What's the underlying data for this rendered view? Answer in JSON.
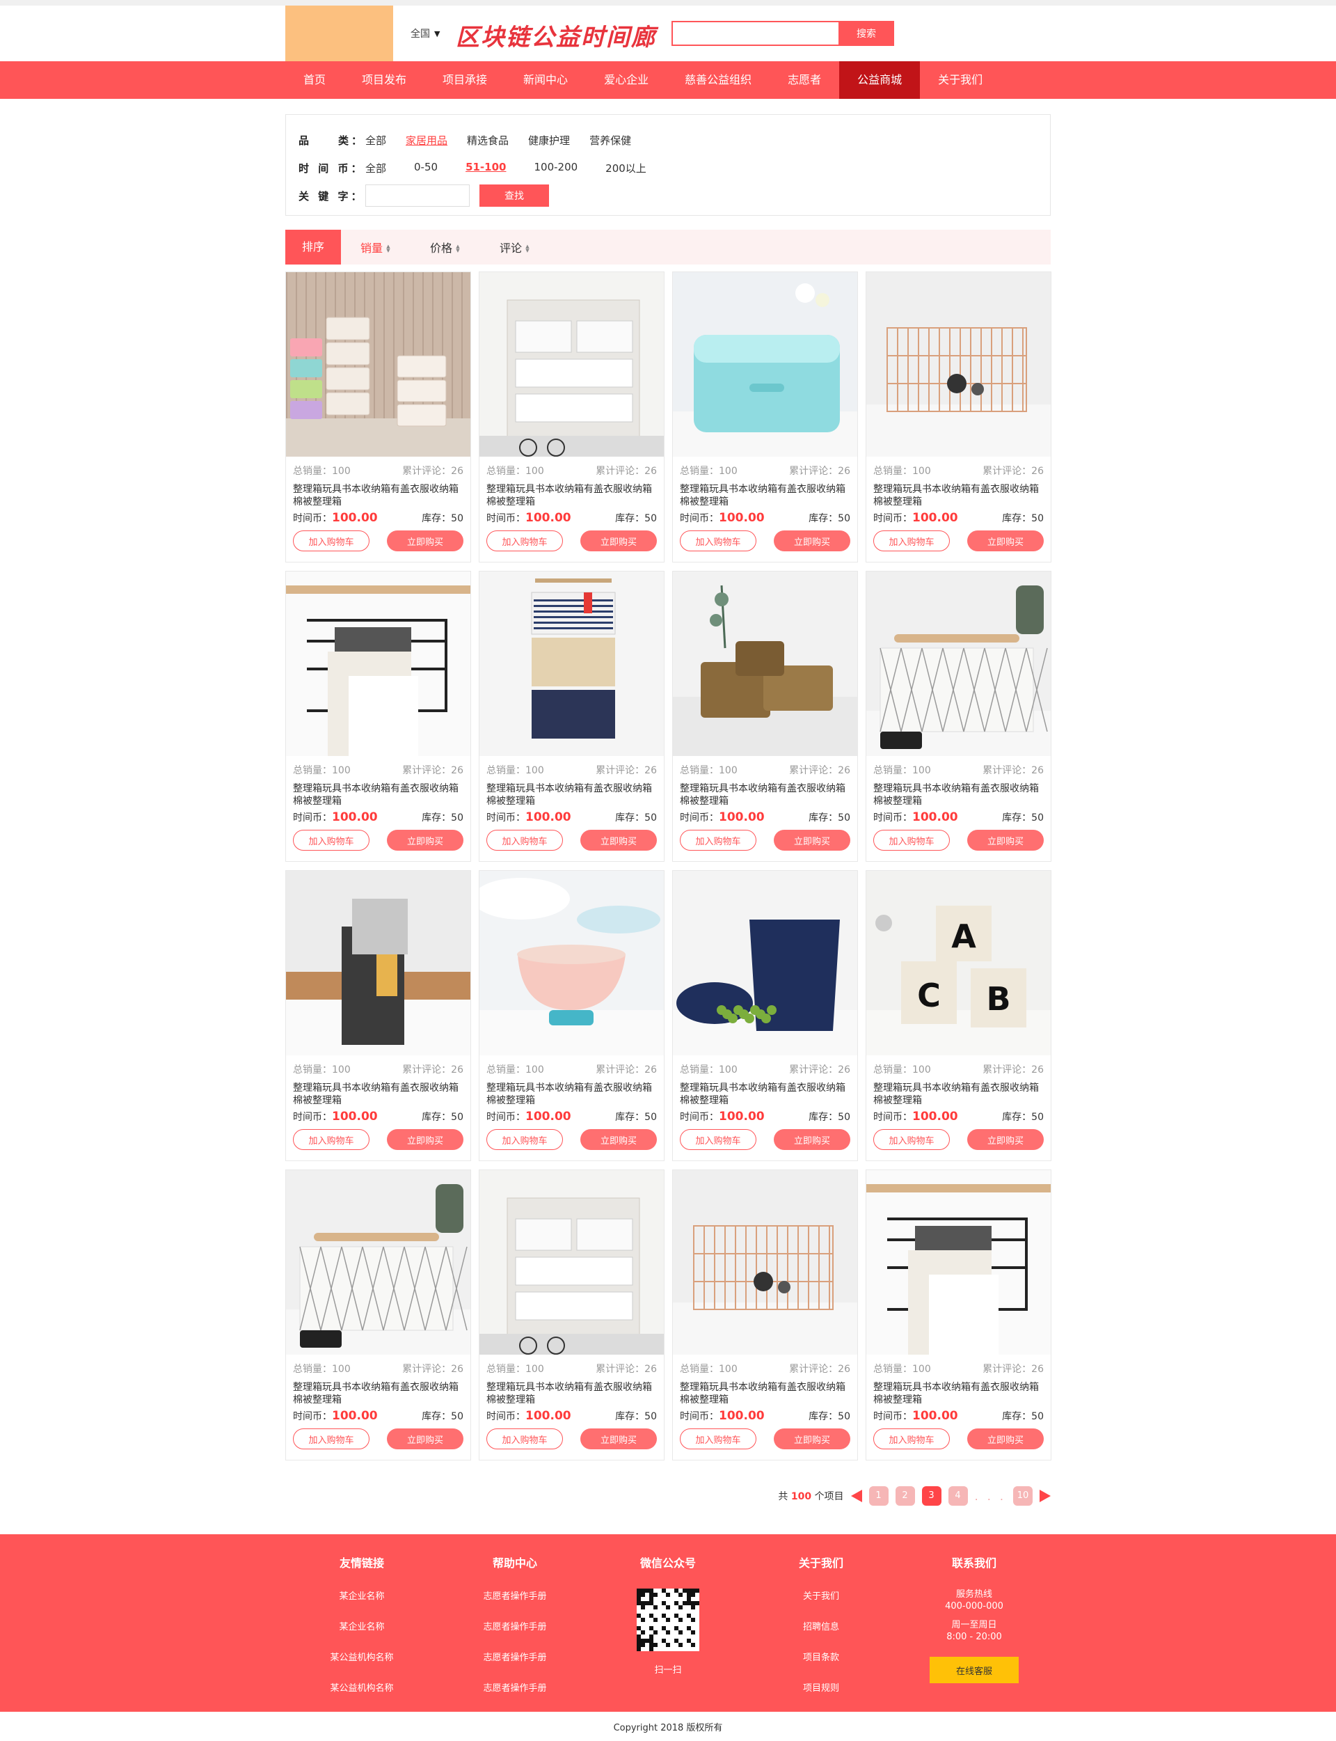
{
  "header": {
    "city": "全国",
    "brand": "区块链公益时间廊",
    "search_placeholder": "",
    "search_button": "搜索"
  },
  "nav": [
    "首页",
    "项目发布",
    "项目承接",
    "新闻中心",
    "爱心企业",
    "慈善公益组织",
    "志愿者",
    "公益商城",
    "关于我们"
  ],
  "nav_active_index": 7,
  "filter": {
    "category_label": "品　　类：",
    "categories": [
      "全部",
      "家居用品",
      "精选食品",
      "健康护理",
      "营养保健"
    ],
    "category_selected": 1,
    "coin_label": "时 间 币：",
    "coin_ranges": [
      "全部",
      "0-50",
      "51-100",
      "100-200",
      "200以上"
    ],
    "coin_selected": 2,
    "keyword_label": "关 键 字：",
    "find_button": "查找"
  },
  "sort": {
    "head": "排序",
    "items": [
      "销量",
      "价格",
      "评论"
    ],
    "active_index": 0
  },
  "product_template": {
    "sales": "总销量：100",
    "reviews": "累计评论：26",
    "title": "整理箱玩具书本收纳箱有盖衣服收纳箱棉被整理箱",
    "coin_label": "时间币：",
    "price": "100.00",
    "stock": "库存：50",
    "cart_button": "加入购物车",
    "buy_button": "立即购买"
  },
  "products": [
    {
      "image": "plastic-drawers"
    },
    {
      "image": "desk-drawer-box"
    },
    {
      "image": "blue-storage-bag"
    },
    {
      "image": "rose-gold-wire-basket"
    },
    {
      "image": "pants-hanger"
    },
    {
      "image": "hanging-wall-pockets"
    },
    {
      "image": "woven-baskets"
    },
    {
      "image": "fabric-basket"
    },
    {
      "image": "bedside-caddy"
    },
    {
      "image": "ceramic-bowl"
    },
    {
      "image": "navy-laundry-bag"
    },
    {
      "image": "alphabet-baskets"
    },
    {
      "image": "fabric-basket"
    },
    {
      "image": "desk-drawer-box"
    },
    {
      "image": "rose-gold-wire-basket"
    },
    {
      "image": "pants-hanger"
    }
  ],
  "pager": {
    "total_prefix": "共",
    "total": "100",
    "total_suffix": "个项目",
    "pages": [
      "1",
      "2",
      "3",
      "4"
    ],
    "current": "3",
    "ellipsis": ". . .",
    "last": "10"
  },
  "footer": {
    "columns": [
      {
        "title": "友情链接",
        "items": [
          "某企业名称",
          "某企业名称",
          "某公益机构名称",
          "某公益机构名称"
        ]
      },
      {
        "title": "帮助中心",
        "items": [
          "志愿者操作手册",
          "志愿者操作手册",
          "志愿者操作手册",
          "志愿者操作手册"
        ]
      },
      {
        "title": "微信公众号",
        "caption": "扫一扫"
      },
      {
        "title": "关于我们",
        "items": [
          "关于我们",
          "招聘信息",
          "项目条款",
          "项目规则"
        ]
      },
      {
        "title": "联系我们",
        "hotline_label": "服务热线",
        "hotline": "400-000-000",
        "hours_label": "周一至周日",
        "hours": "8:00 - 20:00",
        "chat_button": "在线客服"
      }
    ],
    "copyright": "Copyright 2018 版权所有"
  },
  "colors": {
    "primary": "#ff5557",
    "nav_active": "#c11418",
    "logo": "#fcc07f",
    "accent": "#ffc107"
  }
}
